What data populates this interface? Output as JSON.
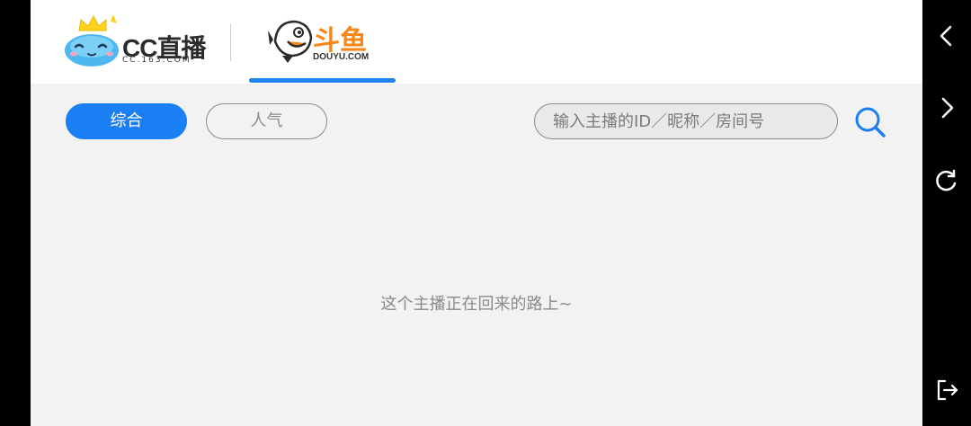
{
  "tabs": {
    "cc": {
      "brand": "CC直播",
      "domain": "CC.163.COM"
    },
    "douyu": {
      "brand": "斗鱼",
      "domain": "DOUYU.COM"
    }
  },
  "filters": [
    {
      "label": "综合",
      "active": true
    },
    {
      "label": "人气",
      "active": false
    }
  ],
  "search": {
    "placeholder": "输入主播的ID／昵称／房间号",
    "value": ""
  },
  "empty_message": "这个主播正在回来的路上~",
  "colors": {
    "accent": "#1a7ff2",
    "douyu_orange": "#f7861b",
    "cc_mascot": "#4db8f0",
    "cc_crown": "#ffd21f"
  },
  "side_nav_icons": [
    "back-icon",
    "forward-icon",
    "refresh-icon",
    "exit-icon"
  ]
}
